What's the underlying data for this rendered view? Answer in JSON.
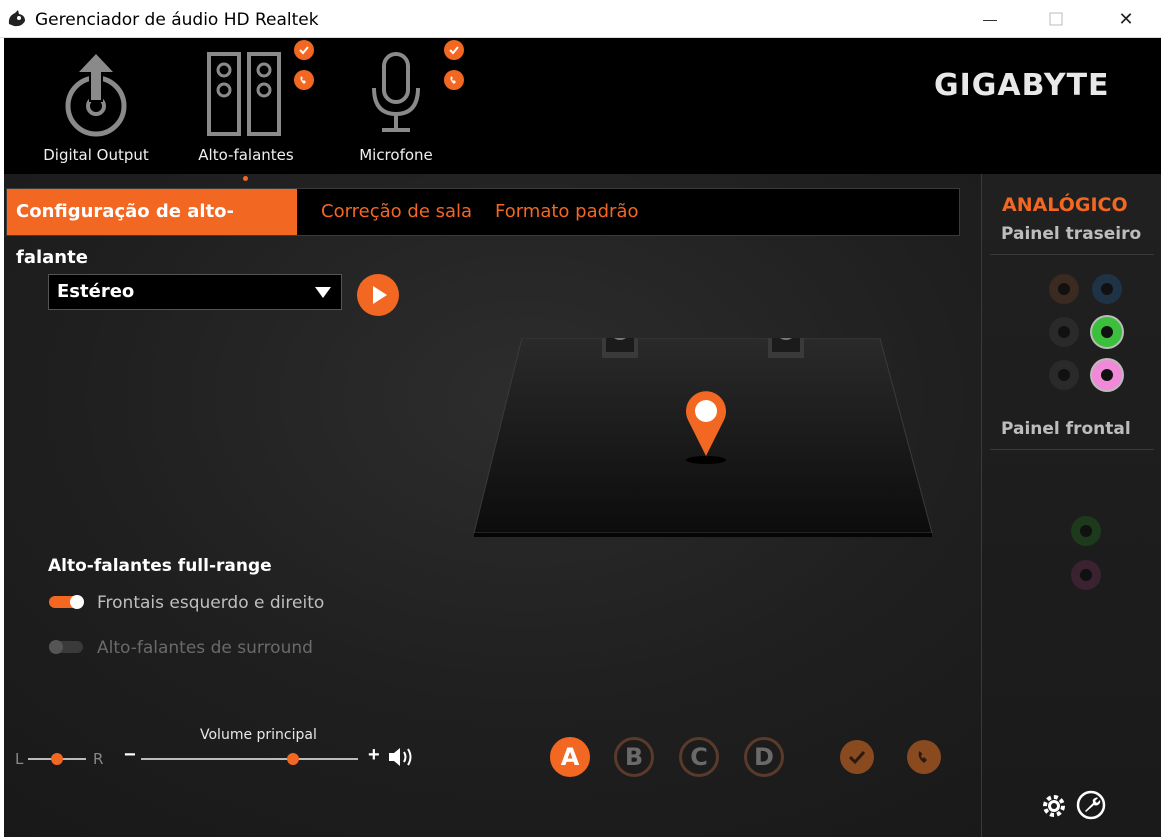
{
  "window": {
    "title": "Gerenciador de áudio HD Realtek",
    "min_glyph": "—",
    "close_glyph": "✕"
  },
  "devices": [
    {
      "label": "Digital Output",
      "icon": "digital-output-icon"
    },
    {
      "label": "Alto-falantes",
      "icon": "speakers-icon",
      "selected": true
    },
    {
      "label": "Microfone",
      "icon": "microphone-icon"
    }
  ],
  "brand": "GIGABYTE",
  "tabs": {
    "active": "Configuração de alto-falante",
    "room": "Correção de sala",
    "format": "Formato padrão"
  },
  "speaker_config": {
    "selected": "Estéreo",
    "play_icon": "play-icon"
  },
  "full_range": {
    "title": "Alto-falantes full-range",
    "front": {
      "label": "Frontais esquerdo e direito",
      "on": true
    },
    "surround": {
      "label": "Alto-falantes de surround",
      "on": false
    }
  },
  "volume": {
    "title": "Volume principal",
    "left": "L",
    "right": "R",
    "minus": "−",
    "plus": "+",
    "balance": 0.5,
    "level": 0.7
  },
  "profiles": [
    "A",
    "B",
    "C",
    "D"
  ],
  "right_panel": {
    "title": "ANALÓGICO",
    "rear": "Painel traseiro",
    "front": "Painel frontal"
  },
  "colors": {
    "accent": "#f26722",
    "jack_green": "#3cbf3c",
    "jack_pink": "#f08ad8",
    "jack_blue": "#2a6fa0",
    "jack_orange": "#a05a2a"
  }
}
